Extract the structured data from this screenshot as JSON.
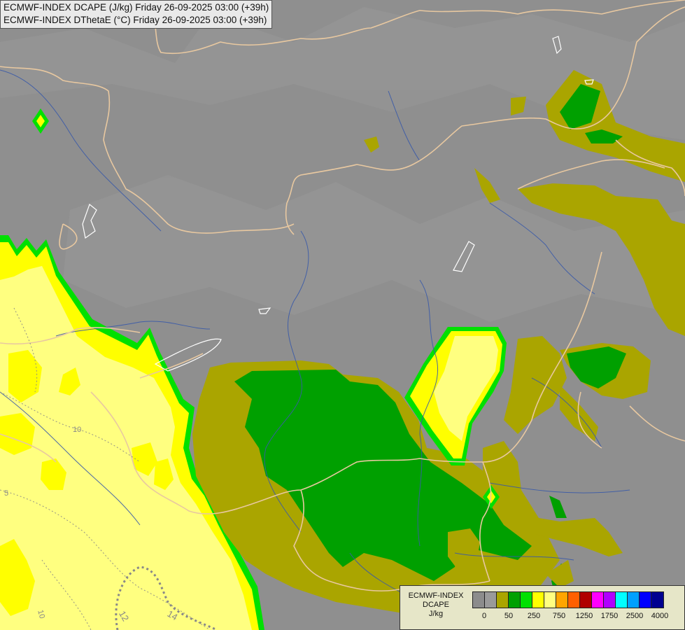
{
  "header": {
    "line1": "ECMWF-INDEX DCAPE (J/kg) Friday 26-09-2025 03:00 (+39h)",
    "line2": "ECMWF-INDEX DThetaE (°C) Friday 26-09-2025 03:00 (+39h)"
  },
  "legend": {
    "line1": "ECMWF-INDEX",
    "line2": "DCAPE",
    "line3": "J/kg",
    "colors": [
      "#8c8c8c",
      "#9a9a9a",
      "#aaa500",
      "#00a000",
      "#00e000",
      "#ffff00",
      "#ffff80",
      "#ffa500",
      "#ff6000",
      "#b00000",
      "#ff00ff",
      "#b000ff",
      "#00ffff",
      "#00a0ff",
      "#0000ff",
      "#000090"
    ],
    "ticks": [
      "0",
      "50",
      "250",
      "750",
      "1250",
      "1750",
      "2500",
      "4000"
    ]
  },
  "contour_labels": [
    "10",
    "5",
    "10",
    "12",
    "14"
  ]
}
